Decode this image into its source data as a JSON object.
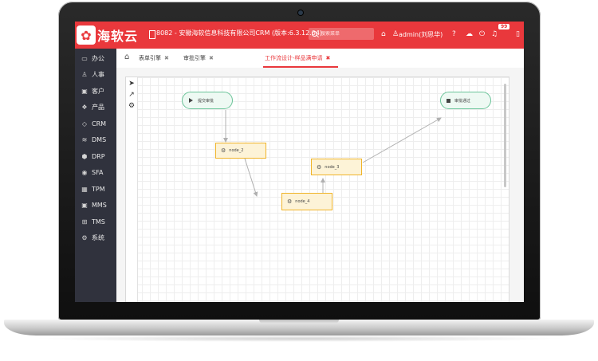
{
  "header": {
    "logo_text": "海软云",
    "title": "8082 - 安徽海软信息科技有限公司CRM (版本:6.3.12.04)",
    "search_placeholder": "搜索菜单",
    "user": "admin(刘思华)",
    "badge": "99"
  },
  "sidebar": {
    "items": [
      {
        "label": "办公",
        "icon": "monitor-icon",
        "glyph": "▭"
      },
      {
        "label": "人事",
        "icon": "users-icon",
        "glyph": "♙"
      },
      {
        "label": "客户",
        "icon": "briefcase-icon",
        "glyph": "▣"
      },
      {
        "label": "产品",
        "icon": "cubes-icon",
        "glyph": "❖"
      },
      {
        "label": "CRM",
        "icon": "tag-icon",
        "glyph": "◇"
      },
      {
        "label": "DMS",
        "icon": "database-icon",
        "glyph": "≋"
      },
      {
        "label": "DRP",
        "icon": "cube-icon",
        "glyph": "⬢"
      },
      {
        "label": "SFA",
        "icon": "location-icon",
        "glyph": "◉"
      },
      {
        "label": "TPM",
        "icon": "table-icon",
        "glyph": "▦"
      },
      {
        "label": "MMS",
        "icon": "camera-icon",
        "glyph": "▣"
      },
      {
        "label": "TMS",
        "icon": "plus-square-icon",
        "glyph": "⊞"
      },
      {
        "label": "系统",
        "icon": "gear-icon",
        "glyph": "⚙"
      }
    ]
  },
  "tabs": [
    {
      "label": "表单引擎",
      "close": "✖"
    },
    {
      "label": "审批引擎",
      "close": "✖"
    },
    {
      "label": "工作流设计-样品满申请",
      "close": "✖",
      "active": true
    }
  ],
  "workflow": {
    "nodes": [
      {
        "id": "start",
        "label": "提交审批"
      },
      {
        "id": "node_2",
        "label": "node_2"
      },
      {
        "id": "node_3",
        "label": "node_3"
      },
      {
        "id": "node_4",
        "label": "node_4"
      },
      {
        "id": "end",
        "label": "审批通过"
      }
    ]
  },
  "colors": {
    "accent": "#e9383c",
    "sidebar_bg": "#30323d",
    "task_border": "#f0b429",
    "event_border": "#6cc49a"
  }
}
